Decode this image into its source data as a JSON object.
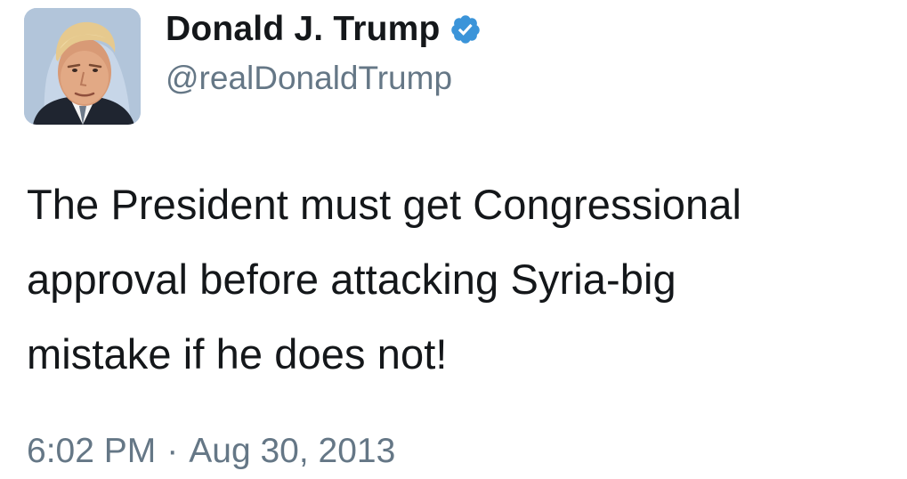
{
  "author": {
    "display_name": "Donald J. Trump",
    "handle": "@realDonaldTrump",
    "verified": true,
    "verified_color": "#3B94D9",
    "avatar_icon": "profile-photo"
  },
  "tweet": {
    "text_lines": [
      "The President must get Congressional",
      "approval before attacking Syria-big",
      "mistake if he does not!"
    ],
    "time": "6:02 PM",
    "separator": "·",
    "date": "Aug 30, 2013"
  }
}
